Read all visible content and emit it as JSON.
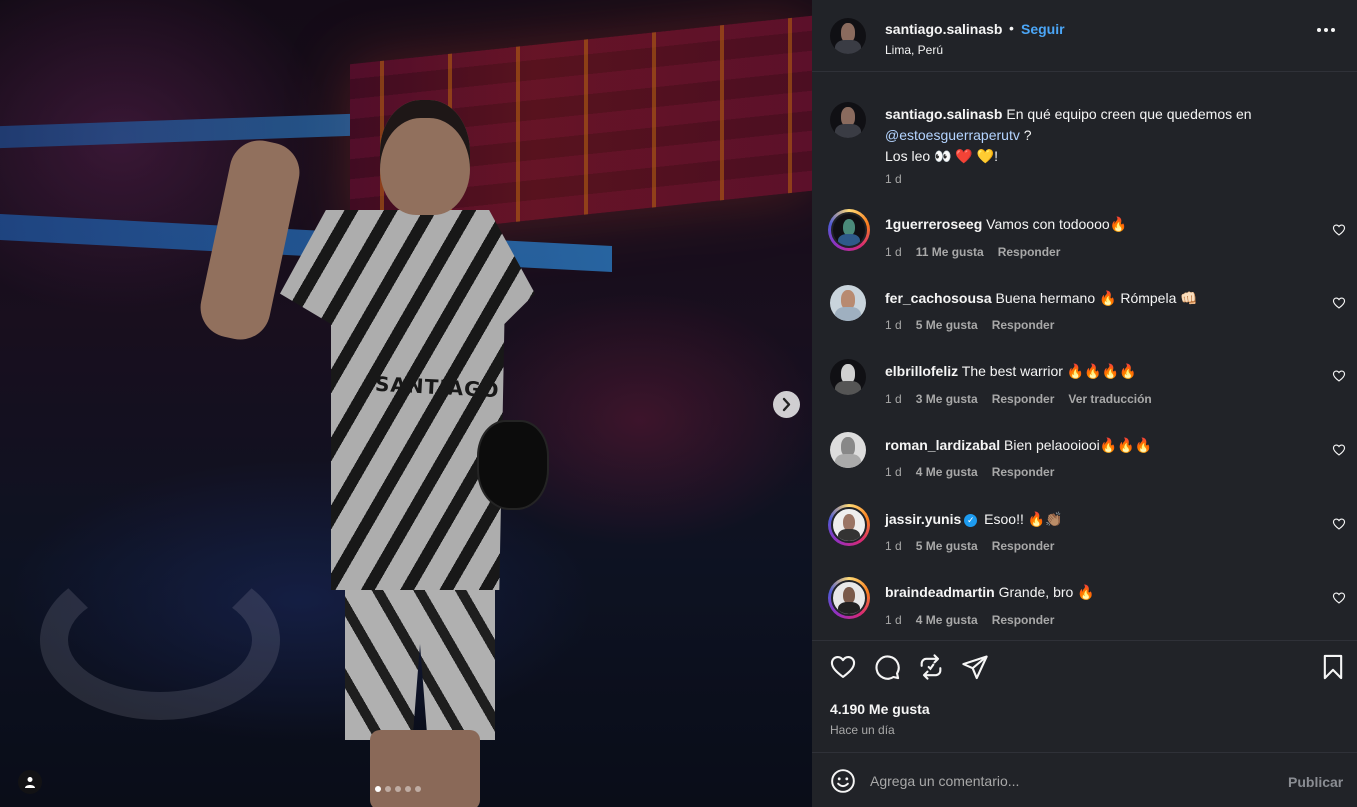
{
  "post": {
    "username": "santiago.salinasb",
    "separator": "•",
    "follow_label": "Seguir",
    "location": "Lima, Perú",
    "more_icon": "more-horizontal-icon"
  },
  "media": {
    "shirt_text": "SANTIAGO",
    "carousel_dots": 5,
    "active_dot": 1,
    "next_icon": "chevron-right-icon",
    "tags_icon": "user-tag-icon"
  },
  "caption": {
    "username": "santiago.salinasb",
    "text_before": "En qué equipo creen que quedemos en",
    "mention": "@estoesguerraperutv",
    "text_after": "?",
    "line2": "Los leo 👀 ❤️ 💛!",
    "time": "1 d"
  },
  "comments": [
    {
      "username": "1guerreroseeg",
      "verified": false,
      "text": "Vamos con todoooo🔥",
      "time": "1 d",
      "likes": "11 Me gusta",
      "reply": "Responder",
      "extra": "",
      "story_ring": true
    },
    {
      "username": "fer_cachosousa",
      "verified": false,
      "text": "Buena hermano 🔥 Rómpela 👊🏻",
      "time": "1 d",
      "likes": "5 Me gusta",
      "reply": "Responder",
      "extra": "",
      "story_ring": false
    },
    {
      "username": "elbrillofeliz",
      "verified": false,
      "text": "The best warrior 🔥🔥🔥🔥",
      "time": "1 d",
      "likes": "3 Me gusta",
      "reply": "Responder",
      "extra": "Ver traducción",
      "story_ring": false
    },
    {
      "username": "roman_lardizabal",
      "verified": false,
      "text": "Bien pelaooiooi🔥🔥🔥",
      "time": "1 d",
      "likes": "4 Me gusta",
      "reply": "Responder",
      "extra": "",
      "story_ring": false
    },
    {
      "username": "jassir.yunis",
      "verified": true,
      "text": "Esoo!! 🔥👏🏽",
      "time": "1 d",
      "likes": "5 Me gusta",
      "reply": "Responder",
      "extra": "",
      "story_ring": true
    },
    {
      "username": "braindeadmartin",
      "verified": false,
      "text": "Grande, bro 🔥",
      "time": "1 d",
      "likes": "4 Me gusta",
      "reply": "Responder",
      "extra": "",
      "story_ring": true
    }
  ],
  "actions": {
    "like_icon": "heart-icon",
    "comment_icon": "comment-icon",
    "repost_icon": "repost-icon",
    "share_icon": "send-icon",
    "save_icon": "bookmark-icon",
    "likes_count": "4.190 Me gusta",
    "posted": "Hace un día"
  },
  "composer": {
    "emoji_icon": "emoji-icon",
    "placeholder": "Agrega un comentario...",
    "value": "",
    "publish_label": "Publicar"
  },
  "colors": {
    "panel_bg": "#212328",
    "link_blue": "#4ba6f7",
    "muted_text": "#a8a8a8"
  }
}
